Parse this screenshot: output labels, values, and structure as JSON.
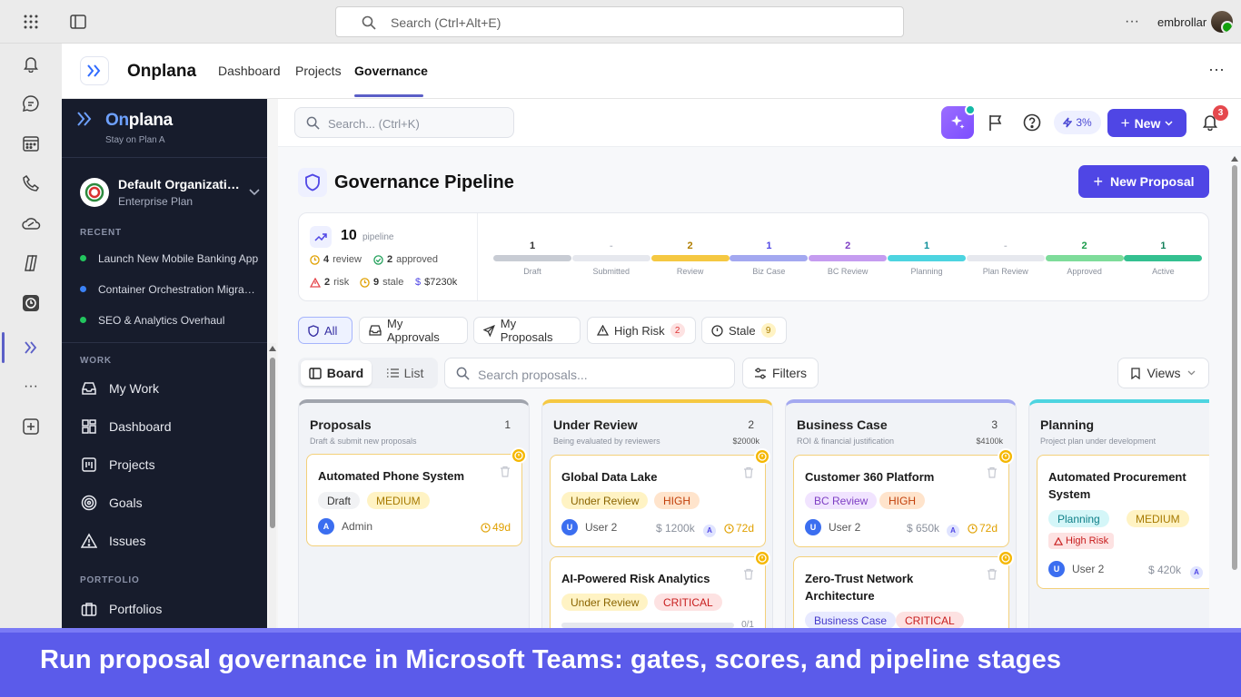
{
  "teams": {
    "search_placeholder": "Search (Ctrl+Alt+E)",
    "user_name": "embrollar"
  },
  "app": {
    "name": "Onplana",
    "tabs": [
      "Dashboard",
      "Projects",
      "Governance"
    ],
    "active_tab": "Governance"
  },
  "sidebar": {
    "brand_on": "On",
    "brand_plana": "plana",
    "tagline": "Stay on Plan A",
    "org_name": "Default Organization",
    "org_plan": "Enterprise Plan",
    "recent_label": "RECENT",
    "recent": [
      {
        "label": "Launch New Mobile Banking App",
        "color": "#22c55e"
      },
      {
        "label": "Container Orchestration Migration",
        "color": "#3b82f6"
      },
      {
        "label": "SEO & Analytics Overhaul",
        "color": "#22c55e"
      }
    ],
    "work_label": "WORK",
    "work": [
      "My Work",
      "Dashboard",
      "Projects",
      "Goals",
      "Issues"
    ],
    "portfolio_label": "PORTFOLIO",
    "portfolio": [
      "Portfolios"
    ]
  },
  "topbar": {
    "search_placeholder": "Search... (Ctrl+K)",
    "usage_percent": "3%",
    "new_label": "New",
    "notification_count": "3"
  },
  "page": {
    "title": "Governance Pipeline",
    "new_proposal_label": "New Proposal"
  },
  "stats": {
    "pipeline_count": "10",
    "pipeline_label": "pipeline",
    "review_count": "4",
    "review_label": "review",
    "approved_count": "2",
    "approved_label": "approved",
    "risk_count": "2",
    "risk_label": "risk",
    "stale_count": "9",
    "stale_label": "stale",
    "value": "$7230k",
    "stages": [
      {
        "name": "Draft",
        "count": "1",
        "color": "#c8ccd4"
      },
      {
        "name": "Submitted",
        "count": "-",
        "color": "#e6e8ee"
      },
      {
        "name": "Review",
        "count": "2",
        "color": "#f5c842",
        "textcolor": "#b07d00"
      },
      {
        "name": "Biz Case",
        "count": "1",
        "color": "#a3a8f0",
        "textcolor": "#4f46e5"
      },
      {
        "name": "BC Review",
        "count": "2",
        "color": "#c59cf0",
        "textcolor": "#7e3fc4"
      },
      {
        "name": "Planning",
        "count": "1",
        "color": "#4dd4e0",
        "textcolor": "#0e8f9a"
      },
      {
        "name": "Plan Review",
        "count": "-",
        "color": "#e6e8ee"
      },
      {
        "name": "Approved",
        "count": "2",
        "color": "#7edc9a",
        "textcolor": "#1a9b4a"
      },
      {
        "name": "Active",
        "count": "1",
        "color": "#34c090",
        "textcolor": "#12805a"
      }
    ]
  },
  "filters": {
    "all": "All",
    "my_approvals": "My Approvals",
    "my_proposals": "My Proposals",
    "high_risk": "High Risk",
    "high_risk_count": "2",
    "stale": "Stale",
    "stale_count": "9"
  },
  "toolbar": {
    "board": "Board",
    "list": "List",
    "search_placeholder": "Search proposals...",
    "filters": "Filters",
    "views": "Views"
  },
  "columns": [
    {
      "title": "Proposals",
      "count": "1",
      "desc": "Draft & submit new proposals",
      "value": "",
      "color": "#a0a4ad",
      "cards": [
        {
          "title": "Automated Phone System",
          "status": "Draft",
          "priority": "MEDIUM",
          "user": "Admin",
          "initial": "A",
          "amount": "",
          "days": "49d"
        }
      ]
    },
    {
      "title": "Under Review",
      "count": "2",
      "desc": "Being evaluated by reviewers",
      "value": "$2000k",
      "color": "#f5c842",
      "cards": [
        {
          "title": "Global Data Lake",
          "status": "Under Review",
          "priority": "HIGH",
          "user": "User 2",
          "initial": "U",
          "amount": "$ 1200k",
          "days": "72d"
        },
        {
          "title": "AI-Powered Risk Analytics",
          "status": "Under Review",
          "priority": "CRITICAL",
          "progress": "0/1"
        }
      ]
    },
    {
      "title": "Business Case",
      "count": "3",
      "desc": "ROI & financial justification",
      "value": "$4100k",
      "color": "#a3a8f0",
      "cards": [
        {
          "title": "Customer 360 Platform",
          "status": "BC Review",
          "priority": "HIGH",
          "user": "User 2",
          "initial": "U",
          "amount": "$ 650k",
          "days": "72d"
        },
        {
          "title": "Zero-Trust Network Architecture",
          "status": "Business Case",
          "priority": "CRITICAL"
        }
      ]
    },
    {
      "title": "Planning",
      "count": "",
      "desc": "Project plan under development",
      "value": "",
      "color": "#4dd4e0",
      "cards": [
        {
          "title": "Automated Procurement System",
          "status": "Planning",
          "priority": "MEDIUM",
          "risk": "High Risk",
          "user": "User 2",
          "initial": "U",
          "amount": "$ 420k"
        }
      ]
    }
  ],
  "caption": "Run proposal governance in Microsoft Teams: gates, scores, and pipeline stages"
}
